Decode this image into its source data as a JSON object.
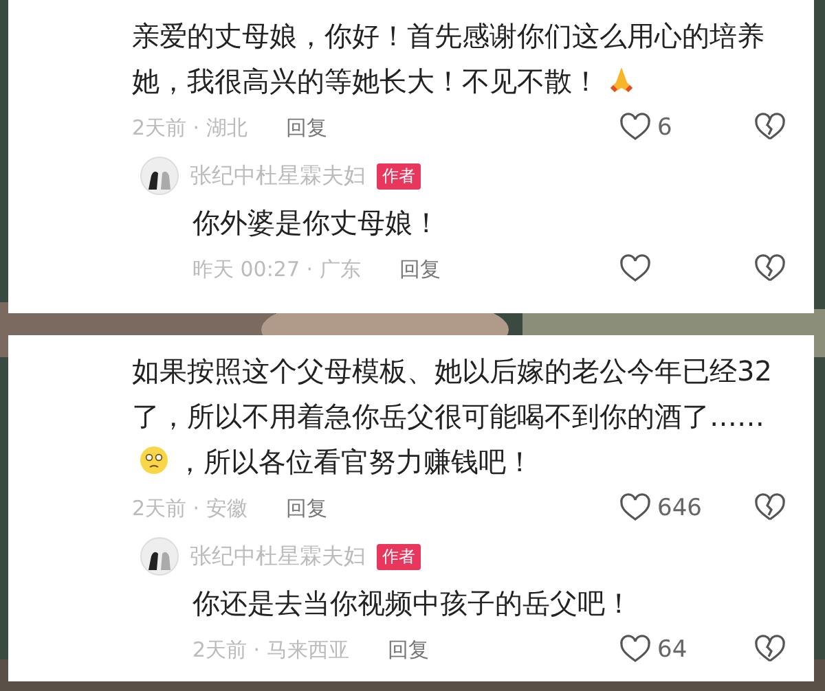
{
  "comments": [
    {
      "segments": [
        {
          "kind": "text",
          "text": "亲爱的丈母娘，你好！首先感谢你们这么用心的培养她，我很高兴的等她长大！不见不散！"
        },
        {
          "kind": "pray"
        }
      ],
      "meta": "2天前 · 湖北",
      "reply_label": "回复",
      "likes": "6",
      "reply": {
        "author": "张纪中杜星霖夫妇",
        "badge": "作者",
        "segments": [
          {
            "kind": "text",
            "text": "你外婆是你丈母娘！"
          }
        ],
        "meta": "昨天 00:27 · 广东",
        "reply_label": "回复"
      }
    },
    {
      "segments": [
        {
          "kind": "text",
          "text": "如果按照这个父母模板、她以后嫁的老公今年已经32了，所以不用着急你岳父很可能喝不到你的酒了……"
        },
        {
          "kind": "sob"
        },
        {
          "kind": "text",
          "text": "，所以各位看官努力赚钱吧！"
        }
      ],
      "meta": "2天前 · 安徽",
      "reply_label": "回复",
      "likes": "646",
      "reply": {
        "author": "张纪中杜星霖夫妇",
        "badge": "作者",
        "segments": [
          {
            "kind": "text",
            "text": "你还是去当你视频中孩子的岳父吧！"
          }
        ],
        "meta": "2天前 · 马来西亚",
        "reply_label": "回复",
        "likes": "64"
      }
    }
  ]
}
